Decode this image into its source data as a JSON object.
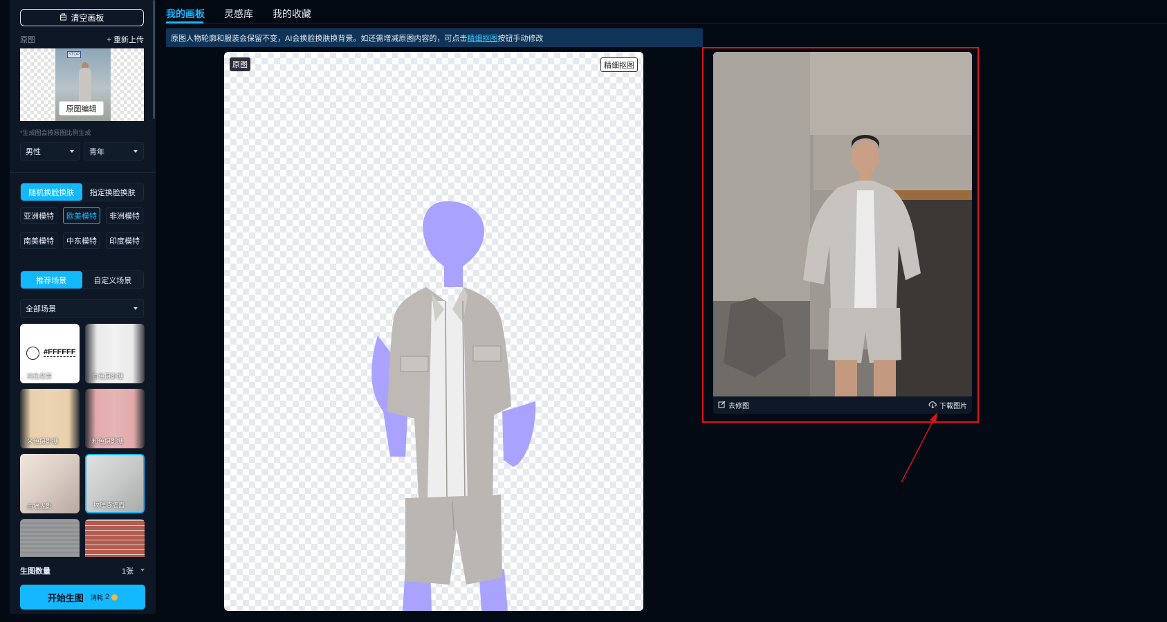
{
  "sidebar": {
    "clear_canvas": "清空画板",
    "original_label": "原图",
    "reupload": "+ 重新上传",
    "thumb_sign": "STOP",
    "original_edit": "原图编辑",
    "ratio_note": "*生成图会按原图比例生成",
    "gender": "男性",
    "age": "青年",
    "face_modes": [
      "随机换脸换肤",
      "指定换脸换肤"
    ],
    "models": [
      "亚洲模特",
      "欧美模特",
      "非洲模特",
      "南美模特",
      "中东模特",
      "印度模特"
    ],
    "active_model_index": 1,
    "scene_modes": [
      "推荐场景",
      "自定义场景"
    ],
    "scene_filter": "全部场景",
    "solid_color": "#FFFFFF",
    "scenes": [
      {
        "label": "纯色背景",
        "color": "#ffffff"
      },
      {
        "label": "白色摄影棚",
        "color": "#e9e9ea"
      },
      {
        "label": "米色摄影棚",
        "color": "#e9cfaa"
      },
      {
        "label": "粉色摄影棚",
        "color": "#e2a9ab"
      },
      {
        "label": "白墙光影",
        "color": "#e6dcd4"
      },
      {
        "label": "纹理感墙面",
        "color": "#cfd1d1"
      },
      {
        "label": "",
        "color": "#8d8f91"
      },
      {
        "label": "",
        "color": "#b55a4e"
      }
    ],
    "active_scene_index": 5,
    "count_label": "生图数量",
    "count_value": "1张",
    "start_button": "开始生图",
    "cost_label": "消耗",
    "cost_value": "2"
  },
  "tabs": [
    "我的画板",
    "灵感库",
    "我的收藏"
  ],
  "info": {
    "text_before": "原图人物轮廓和服装会保留不变，AI会换脸换肤换背景。如还需增减原图内容的，可点击",
    "link": "精细抠图",
    "text_after": "按钮手动修改"
  },
  "canvas": {
    "badge": "原图",
    "refine": "精细抠图",
    "mask_color": "#a9a3ff"
  },
  "result": {
    "retouch": "去修图",
    "download": "下载图片"
  },
  "colors": {
    "accent": "#14b8ff",
    "highlight": "#e01212"
  }
}
